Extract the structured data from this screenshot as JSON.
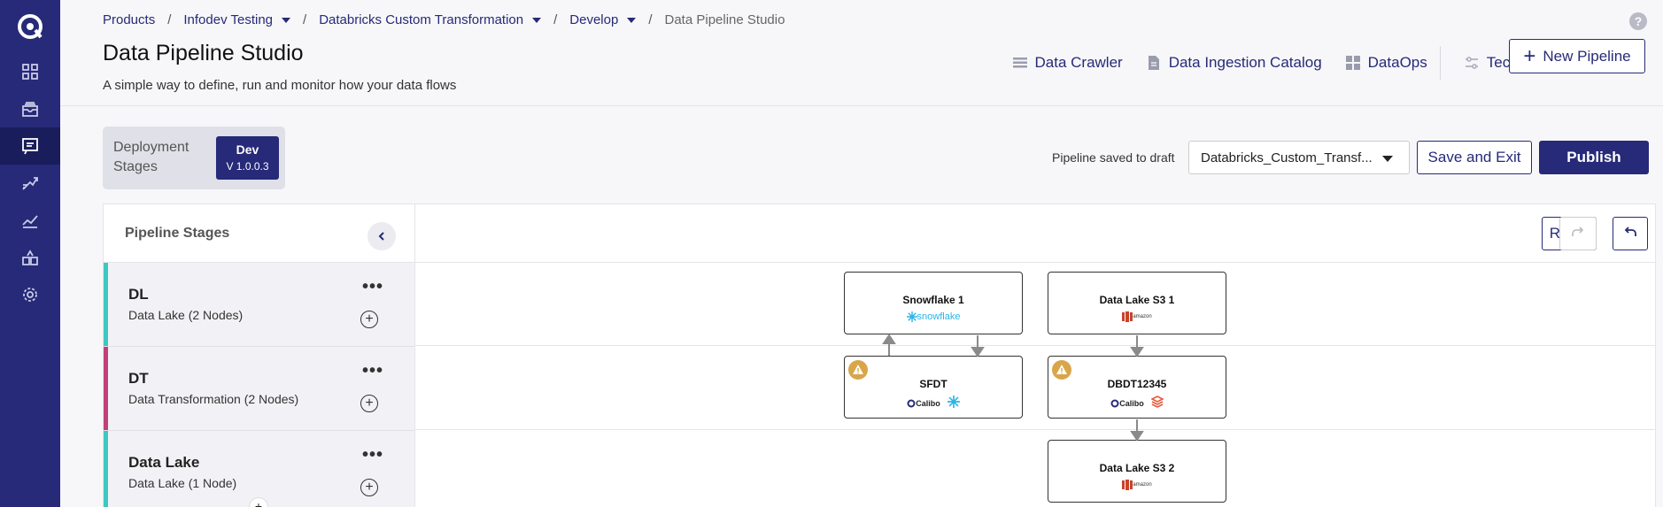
{
  "breadcrumbs": [
    {
      "label": "Products",
      "dropdown": false
    },
    {
      "label": "Infodev Testing",
      "dropdown": true
    },
    {
      "label": "Databricks Custom Transformation",
      "dropdown": true
    },
    {
      "label": "Develop",
      "dropdown": true
    },
    {
      "label": "Data Pipeline Studio",
      "dropdown": false
    }
  ],
  "help_icon": "?",
  "page": {
    "title": "Data Pipeline Studio",
    "subtitle": "A simple way to define, run and monitor how your data flows"
  },
  "nav_links": [
    {
      "label": "Data Crawler",
      "icon": "list-icon"
    },
    {
      "label": "Data Ingestion Catalog",
      "icon": "document-icon"
    },
    {
      "label": "DataOps",
      "icon": "grid-icon"
    },
    {
      "label": "Technologies",
      "icon": "sliders-icon"
    }
  ],
  "new_pipeline": {
    "plus": "+",
    "label": "New Pipeline"
  },
  "deployment": {
    "label": "Deployment Stages",
    "env": "Dev",
    "version": "V 1.0.0.3"
  },
  "draft_status": "Pipeline saved to draft",
  "pipeline_select": {
    "value": "Databricks_Custom_Transf..."
  },
  "actions": {
    "save_exit": "Save and Exit",
    "publish": "Publish"
  },
  "stages_panel": {
    "title": "Pipeline Stages",
    "stages": [
      {
        "name": "DL",
        "desc": "Data Lake (2 Nodes)",
        "color": "#3ec8c0"
      },
      {
        "name": "DT",
        "desc": "Data Transformation (2 Nodes)",
        "color": "#c2407a"
      },
      {
        "name": "Data Lake",
        "desc": "Data Lake (1 Node)",
        "color": "#3ec8c0"
      }
    ],
    "menu_dots": "•••",
    "add": "+"
  },
  "canvas_tools": {
    "reset": "Reset"
  },
  "nodes": [
    {
      "title": "Snowflake 1",
      "logos": [
        "snowflake"
      ],
      "warning": false
    },
    {
      "title": "Data Lake S3 1",
      "logos": [
        "amazon-s3"
      ],
      "warning": false
    },
    {
      "title": "SFDT",
      "logos": [
        "calibo",
        "snowflake-mark"
      ],
      "warning": true
    },
    {
      "title": "DBDT12345",
      "logos": [
        "calibo",
        "databricks"
      ],
      "warning": true
    },
    {
      "title": "Data Lake S3 2",
      "logos": [
        "amazon-s3"
      ],
      "warning": false
    }
  ],
  "logo_text": {
    "snowflake": "snowflake",
    "calibo": "Calibo",
    "amazon": "amazon"
  },
  "colors": {
    "primary": "#262a78",
    "warning": "#d9a54a",
    "snowflake": "#29b5e8",
    "databricks": "#e8593c",
    "aws": "#c7432b"
  }
}
